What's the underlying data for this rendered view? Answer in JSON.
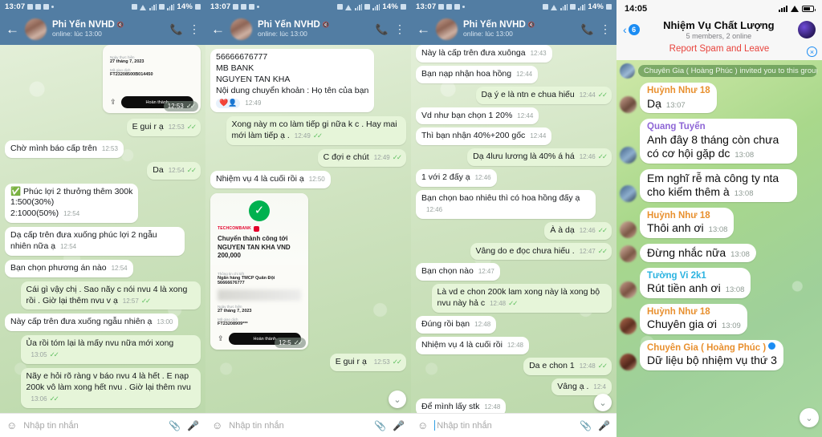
{
  "panels": [
    {
      "app": "telegram",
      "status": {
        "time": "13:07",
        "battery": "14%"
      },
      "header": {
        "name": "Phi Yến NVHD",
        "subtitle": "online: lúc 13:00",
        "back_icon": "back-arrow-icon",
        "call_icon": "phone-icon",
        "menu_icon": "more-vertical-icon"
      },
      "receipt_partial": {
        "date_label": "Ngày thực hiện",
        "date_value": "27 tháng 7, 2023",
        "code_label": "Mã giao dịch",
        "code_value": "FT23208500B014450",
        "share_icon": "share-icon",
        "button": "Hoàn thành",
        "time": "12:53"
      },
      "messages": [
        {
          "side": "out",
          "text": "E gui r ạ",
          "time": "12:53",
          "ticks": true
        },
        {
          "side": "in",
          "text": "Chờ mình báo cấp trên",
          "time": "12:53",
          "ticks": false
        },
        {
          "side": "out",
          "text": "Da",
          "time": "12:54",
          "ticks": true
        },
        {
          "side": "in",
          "text": "✅ Phúc lợi 2 thưởng thêm 300k\n1:500(30%)\n2:1000(50%)",
          "time": "12:54",
          "ticks": false
        },
        {
          "side": "in",
          "text": "Dạ cấp trên đưa xuống phúc lợi 2 ngẫu nhiên nữa ạ",
          "time": "12:54",
          "ticks": false
        },
        {
          "side": "in",
          "text": "Bạn chọn phương án nào",
          "time": "12:54",
          "ticks": false
        },
        {
          "side": "out",
          "text": "Cái gì vậy chị . Sao nãy c nói nvu 4 là xong rồi . Giờ lại thêm nvu v ạ",
          "time": "12:57",
          "ticks": true
        },
        {
          "side": "in",
          "text": "Này cấp trên đưa xuống ngẫu nhiên ạ",
          "time": "13:00",
          "ticks": false
        },
        {
          "side": "out",
          "text": "Ủa rồi tóm lại là mấy nvu nữa mới xong",
          "time": "13:05",
          "ticks": true
        },
        {
          "side": "out",
          "text": "Nãy e hỏi rõ ràng v báo nvu 4 là hết . E nạp 200k vô làm xong hết nvu . Giờ lại thêm nvu",
          "time": "13:06",
          "ticks": true
        }
      ],
      "input": {
        "placeholder": "Nhập tin nhắn",
        "emoji_icon": "emoji-icon",
        "attach_icon": "paperclip-icon",
        "mic_icon": "microphone-icon"
      }
    },
    {
      "app": "telegram",
      "status": {
        "time": "13:07",
        "battery": "14%"
      },
      "header": {
        "name": "Phi Yến NVHD",
        "subtitle": "online: lúc 13:00",
        "back_icon": "back-arrow-icon",
        "call_icon": "phone-icon",
        "menu_icon": "more-vertical-icon"
      },
      "messages": [
        {
          "side": "in",
          "text": "56666676777\nMB BANK\nNGUYEN TAN KHA\nNội dung chuyển khoản : Họ tên của bạn",
          "reactions": "❤️👤",
          "time": "12:49",
          "ticks": false
        },
        {
          "side": "out",
          "text": "Xong này m co làm tiếp gi nữa k c . Hay mai mới làm tiếp ạ .",
          "time": "12:49",
          "ticks": true
        },
        {
          "side": "out",
          "text": "C đợi e chút",
          "time": "12:49",
          "ticks": true
        },
        {
          "side": "in",
          "text": "Nhiệm vụ 4 là cuối rồi ạ",
          "time": "12:50",
          "ticks": false
        }
      ],
      "receipt": {
        "check_icon": "success-check-icon",
        "brand": "TECHCOMBANK",
        "title": "Chuyển thành công\ntới NGUYEN TAN KHA\nVND 200,000",
        "info_label": "Thông tin chi tiết",
        "bank_line": "Ngân hàng TMCP Quân Đội",
        "account": "56666676777",
        "date_label": "Ngày thực hiện",
        "date_value": "27 tháng 7, 2023",
        "code_label": "Mã giao dịch",
        "code_value": "FT23208909***",
        "share_icon": "share-icon",
        "button": "Hoàn thành",
        "time": "12:5"
      },
      "trailing": {
        "side": "out",
        "text": "E gui r ạ",
        "time": "12:53"
      },
      "scroll_icon": "chevron-down-icon",
      "input": {
        "placeholder": "Nhập tin nhắn",
        "emoji_icon": "emoji-icon",
        "attach_icon": "paperclip-icon",
        "mic_icon": "microphone-icon"
      }
    },
    {
      "app": "telegram",
      "status": {
        "time": "13:07",
        "battery": "14%"
      },
      "header": {
        "name": "Phi Yến NVHD",
        "subtitle": "online: lúc 13:00",
        "back_icon": "back-arrow-icon",
        "call_icon": "phone-icon",
        "menu_icon": "more-vertical-icon"
      },
      "messages": [
        {
          "side": "in",
          "text": "Này là cấp trên đưa xuônga",
          "time": "12:43",
          "ticks": false
        },
        {
          "side": "in",
          "text": "Bạn nạp nhận hoa hồng",
          "time": "12:44",
          "ticks": false
        },
        {
          "side": "out",
          "text": "Dạ ý e là ntn e chua hiếu",
          "time": "12:44",
          "ticks": true
        },
        {
          "side": "in",
          "text": "Vd như bạn chọn 1 20%",
          "time": "12:44",
          "ticks": false
        },
        {
          "side": "in",
          "text": "Thì bạn nhận 40%+200 gốc",
          "time": "12:44",
          "ticks": false
        },
        {
          "side": "out",
          "text": "Dạ 4lưu lương là 40% á há",
          "time": "12:46",
          "ticks": true
        },
        {
          "side": "in",
          "text": "1 với 2 đấy ạ",
          "time": "12:46",
          "ticks": false
        },
        {
          "side": "in",
          "text": "Bạn chọn bao nhiêu thì có hoa hồng đấy ạ",
          "time": "12:46",
          "ticks": false
        },
        {
          "side": "out",
          "text": "À à dạ",
          "time": "12:46",
          "ticks": true
        },
        {
          "side": "out",
          "text": "Vâng do e đọc chưa hiếu .",
          "time": "12:47",
          "ticks": true
        },
        {
          "side": "in",
          "text": "Bạn chọn nào",
          "time": "12:47",
          "ticks": false
        },
        {
          "side": "out",
          "text": "Là vd e chon 200k lam xong này là xong bộ nvu này hả c",
          "time": "12:48",
          "ticks": true
        },
        {
          "side": "in",
          "text": "Đúng rồi bạn",
          "time": "12:48",
          "ticks": false
        },
        {
          "side": "in",
          "text": "Nhiệm vụ 4 là cuối rồi",
          "time": "12:48",
          "ticks": false
        },
        {
          "side": "out",
          "text": "Da e chon 1",
          "time": "12:48",
          "ticks": true
        },
        {
          "side": "out",
          "text": "Vâng ạ .",
          "time": "12:4",
          "ticks": false
        },
        {
          "side": "in",
          "text": "Để mình lấy stk",
          "time": "12:48",
          "ticks": false
        }
      ],
      "scroll_icon": "chevron-down-icon",
      "input": {
        "placeholder": "Nhập tin nhắn",
        "emoji_icon": "emoji-icon",
        "attach_icon": "paperclip-icon",
        "mic_icon": "microphone-icon"
      }
    },
    {
      "app": "whatsapp",
      "status": {
        "time": "14:05"
      },
      "header": {
        "back_icon": "back-chevron-icon",
        "unread_badge": "6",
        "title": "Nhiệm Vụ Chất Lượng",
        "subtitle": "5 members, 2 online",
        "group_avatar": "group-avatar",
        "report_label": "Report Spam and Leave",
        "dismiss_icon": "close-circle-icon"
      },
      "system_message": "Chuyên Gia ( Hoàng Phúc ) invited you to this group",
      "messages": [
        {
          "sender": "Huỳnh Như 18",
          "color": "#e8902f",
          "avatar": "a1",
          "text": "Dạ",
          "time": "13:07"
        },
        {
          "sender": "Quang Tuyển",
          "color": "#8e66d6",
          "avatar": "a2",
          "text": "Anh đây 8 tháng còn chưa có cơ hội gặp dc",
          "time": "13:08"
        },
        {
          "sender": "",
          "color": "",
          "avatar": "a2",
          "text": "Em nghĩ rễ mà công ty nta cho kiếm thêm à",
          "time": "13:08"
        },
        {
          "sender": "Huỳnh Như 18",
          "color": "#e8902f",
          "avatar": "a3",
          "text": "Thôi anh ơi",
          "time": "13:08"
        },
        {
          "sender": "",
          "color": "",
          "avatar": "a3",
          "text": "Đừng nhắc nữa",
          "time": "13:08"
        },
        {
          "sender": "Tường Vi 2k1",
          "color": "#2bb3e0",
          "avatar": "a4",
          "text": "Rút tiền anh ơi",
          "time": "13:08"
        },
        {
          "sender": "Huỳnh Như 18",
          "color": "#e8902f",
          "avatar": "a5",
          "text": "Chuyên gia ơi",
          "time": "13:09"
        },
        {
          "sender": "Chuyên Gia ( Hoàng Phúc )",
          "color": "#e8902f",
          "avatar": "a6",
          "verified": true,
          "text": "Dữ liệu bộ nhiệm vụ thứ 3",
          "time": ""
        }
      ],
      "scroll_icon": "chevron-down-icon"
    }
  ]
}
